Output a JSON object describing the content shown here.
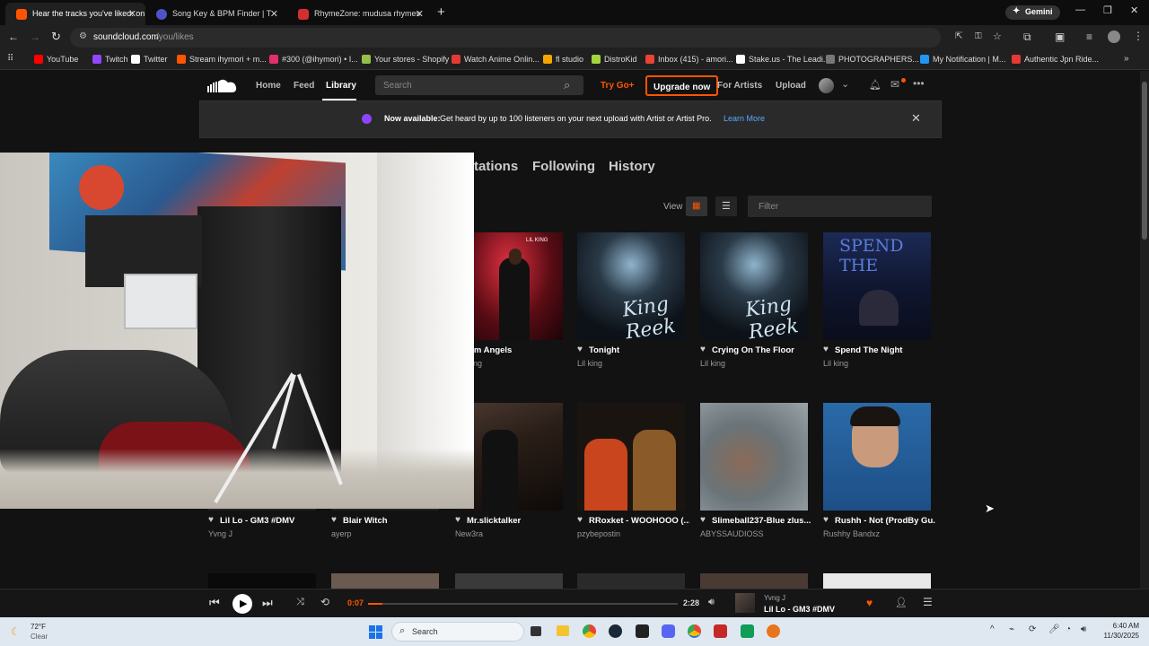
{
  "browser": {
    "tabs": [
      {
        "title": "Hear the tracks you've liked: on",
        "active": true,
        "color": "#ff5500"
      },
      {
        "title": "Song Key & BPM Finder | Tunebat",
        "active": false,
        "color": "#4e54c8"
      },
      {
        "title": "RhymeZone: mudusa rhymes",
        "active": false,
        "color": "#d32f2f"
      }
    ],
    "new_tab": "+",
    "gemini": "Gemini",
    "url_domain": "soundcloud.com",
    "url_path": "/you/likes",
    "bookmarks": [
      {
        "label": "YouTube",
        "color": "#ff0000"
      },
      {
        "label": "Twitch",
        "color": "#9146ff"
      },
      {
        "label": "Twitter",
        "color": "#ffffff"
      },
      {
        "label": "Stream ihymori + m...",
        "color": "#ff5500"
      },
      {
        "label": "#300 (@ihymori) • I...",
        "color": "#e1306c"
      },
      {
        "label": "Your stores - Shopify",
        "color": "#95bf47"
      },
      {
        "label": "Watch Anime Onlin...",
        "color": "#e53935"
      },
      {
        "label": "fl studio",
        "color": "#f7a600"
      },
      {
        "label": "DistroKid",
        "color": "#a5d63f"
      },
      {
        "label": "Inbox (415) - amori...",
        "color": "#ea4335"
      },
      {
        "label": "Stake.us - The Leadi...",
        "color": "#ffffff"
      },
      {
        "label": "PHOTOGRAPHERS...",
        "color": "#777777"
      },
      {
        "label": "My Notification | M...",
        "color": "#2196f3"
      },
      {
        "label": "Authentic Jpn Ride...",
        "color": "#e53935"
      }
    ]
  },
  "soundcloud": {
    "nav": {
      "home": "Home",
      "feed": "Feed",
      "library": "Library",
      "search_placeholder": "Search",
      "try_go": "Try Go+",
      "upgrade": "Upgrade now",
      "for_artists": "For Artists",
      "upload": "Upload"
    },
    "banner": {
      "bold": "Now available:",
      "text": " Get heard by up to 100 listeners on your next upload with Artist or Artist Pro.",
      "link": "Learn More"
    },
    "library_tabs": [
      "tations",
      "Following",
      "History"
    ],
    "view_label": "View",
    "filter_placeholder": "Filter",
    "row1": [
      {
        "title": "alm Angels",
        "artist": "ng"
      },
      {
        "title": "Tonight",
        "artist": "Lil king"
      },
      {
        "title": "Crying On The Floor",
        "artist": "Lil king"
      },
      {
        "title": "Spend The Night",
        "artist": "Lil king"
      }
    ],
    "row2": [
      {
        "title": "Lil Lo - GM3 #DMV",
        "artist": "Yvng J"
      },
      {
        "title": "Blair Witch",
        "artist": "ayerp"
      },
      {
        "title": "Mr.slicktalker",
        "artist": "New3ra"
      },
      {
        "title": "RRoxket - WOOHOOO (...",
        "artist": "pzybepostin"
      },
      {
        "title": "Slimeball237-Blue zlus...",
        "artist": "ABYSSAUDIOSS"
      },
      {
        "title": "Rushh - Not (ProdBy Gu...",
        "artist": "Rushhy Bandxz"
      }
    ],
    "art_texts": {
      "lilking": "LIL KING",
      "kingreek": "King Reek",
      "spendthe": "SPEND THE"
    }
  },
  "player": {
    "elapsed": "0:07",
    "duration": "2:28",
    "progress": 0.047,
    "artist": "Yvng J",
    "title": "Lil Lo - GM3 #DMV"
  },
  "taskbar": {
    "weather_temp": "72°F",
    "weather_desc": "Clear",
    "search": "Search",
    "time": "6:40 AM",
    "date": "11/30/2025"
  }
}
